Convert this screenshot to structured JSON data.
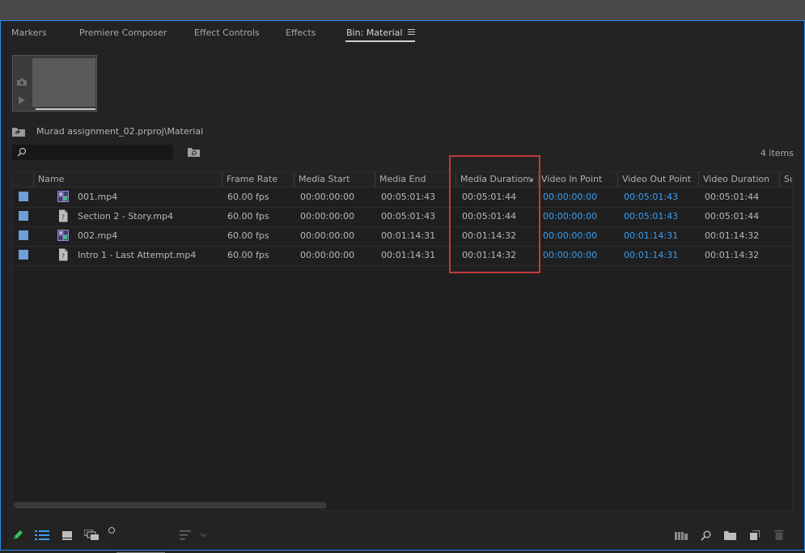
{
  "tabs": [
    {
      "label": "Markers"
    },
    {
      "label": "Premiere Composer"
    },
    {
      "label": "Effect Controls"
    },
    {
      "label": "Effects"
    },
    {
      "label": "Bin: Material"
    }
  ],
  "bin": {
    "path": "Murad assignment_02.prproj\\Material",
    "item_count": "4 items",
    "search_value": ""
  },
  "columns": [
    {
      "label": "Name"
    },
    {
      "label": "Frame Rate"
    },
    {
      "label": "Media Start"
    },
    {
      "label": "Media End"
    },
    {
      "label": "Media Duration"
    },
    {
      "label": "Video In Point"
    },
    {
      "label": "Video Out Point"
    },
    {
      "label": "Video Duration"
    },
    {
      "label": "Su"
    }
  ],
  "rows": [
    {
      "name": "001.mp4",
      "type": "clip",
      "frame_rate": "60.00 fps",
      "media_start": "00:00:00:00",
      "media_end": "00:05:01:43",
      "media_duration": "00:05:01:44",
      "video_in": "00:00:00:00",
      "video_out": "00:05:01:43",
      "video_duration": "00:05:01:44"
    },
    {
      "name": "Section 2 - Story.mp4",
      "type": "missing",
      "frame_rate": "60.00 fps",
      "media_start": "00:00:00:00",
      "media_end": "00:05:01:43",
      "media_duration": "00:05:01:44",
      "video_in": "00:00:00:00",
      "video_out": "00:05:01:43",
      "video_duration": "00:05:01:44"
    },
    {
      "name": "002.mp4",
      "type": "clip",
      "frame_rate": "60.00 fps",
      "media_start": "00:00:00:00",
      "media_end": "00:01:14:31",
      "media_duration": "00:01:14:32",
      "video_in": "00:00:00:00",
      "video_out": "00:01:14:31",
      "video_duration": "00:01:14:32"
    },
    {
      "name": "Intro 1 - Last Attempt.mp4",
      "type": "missing",
      "frame_rate": "60.00 fps",
      "media_start": "00:00:00:00",
      "media_end": "00:01:14:31",
      "media_duration": "00:01:14:32",
      "video_in": "00:00:00:00",
      "video_out": "00:01:14:31",
      "video_duration": "00:01:14:32"
    }
  ],
  "colors": {
    "label_chip": "#6f9fd8",
    "timecode_link": "#3b9ff2",
    "highlight": "#c23a3a",
    "panel_focus": "#2d8ceb"
  },
  "icons": {
    "clip": "video-clip-icon",
    "missing": "missing-media-icon"
  }
}
